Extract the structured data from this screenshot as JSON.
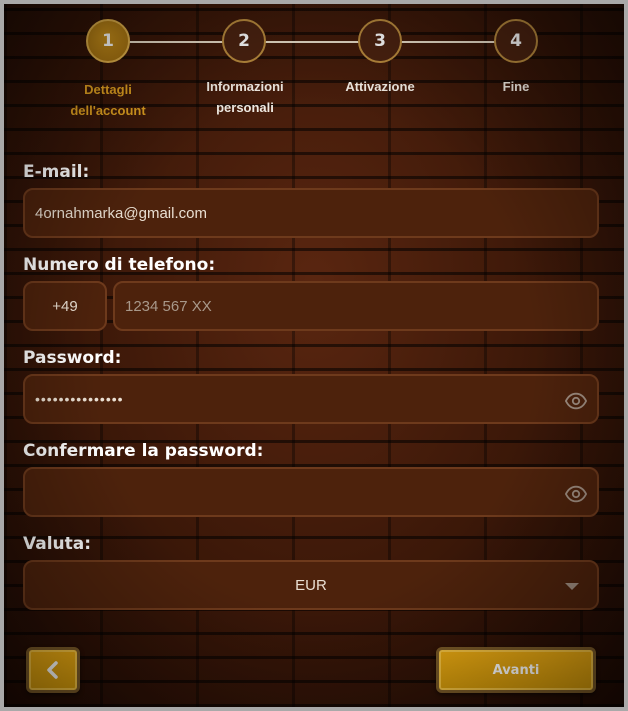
{
  "stepper": {
    "steps": [
      {
        "number": "1",
        "label_line1": "Dettagli",
        "label_line2": "dell'account",
        "active": true
      },
      {
        "number": "2",
        "label_line1": "Informazioni",
        "label_line2": "personali",
        "active": false
      },
      {
        "number": "3",
        "label_line1": "Attivazione",
        "label_line2": "",
        "active": false
      },
      {
        "number": "4",
        "label_line1": "Fine",
        "label_line2": "",
        "active": false
      }
    ]
  },
  "form": {
    "email": {
      "label": "E-mail:",
      "value": "4ornahmarka@gmail.com"
    },
    "phone": {
      "label": "Numero di telefono:",
      "prefix": "+49",
      "placeholder": "1234 567 XX",
      "value": ""
    },
    "password": {
      "label": "Password:",
      "masked_value": "•••••••••••••••"
    },
    "confirm_password": {
      "label": "Confermare la password:",
      "value": ""
    },
    "currency": {
      "label": "Valuta:",
      "selected": "EUR"
    }
  },
  "actions": {
    "back_icon": "chevron-left-icon",
    "next_label": "Avanti"
  },
  "colors": {
    "accent": "#e0a020",
    "button_gold": "#d9a010",
    "input_bg": "#4d220c",
    "input_border": "#6e3a1c"
  }
}
